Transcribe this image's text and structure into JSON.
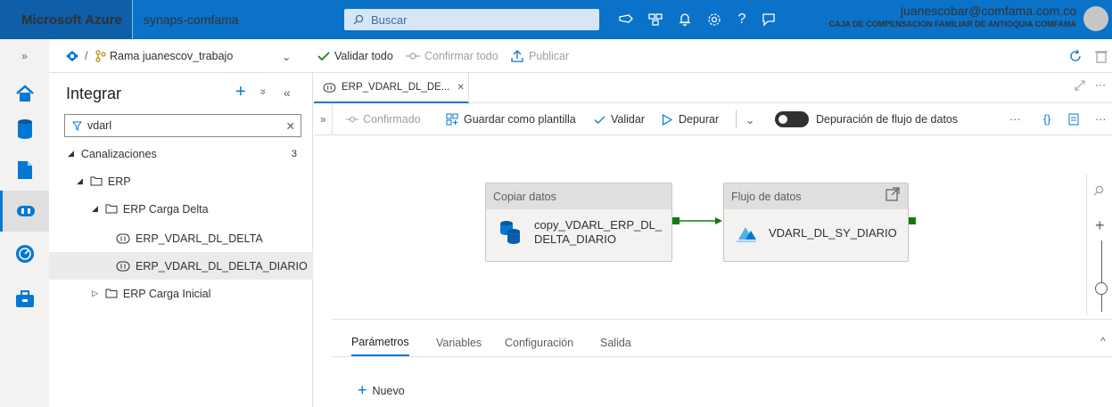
{
  "topbar": {
    "brand": "Microsoft Azure",
    "workspace": "synaps-comfama",
    "search_placeholder": "Buscar",
    "user_email": "juanescobar@comfama.com.co",
    "user_org": "CAJA DE COMPENSACION FAMILIAR DE ANTIOQUIA COMFAMA",
    "icons": [
      "feedback-icon",
      "directory-icon",
      "notifications-icon",
      "settings-icon",
      "help-icon",
      "feedback-smile-icon"
    ],
    "help_glyph": "?"
  },
  "repo_bar": {
    "collapse": "»",
    "separator": "/",
    "branch": "Rama juanescov_trabajo",
    "chevron": "⌄",
    "validate_all": "Validar todo",
    "commit_all": "Confirmar todo",
    "publish": "Publicar"
  },
  "resources": {
    "title": "Integrar",
    "add": "+",
    "collapse_all": "»",
    "hide": "«",
    "filter_value": "vdarl",
    "clear": "✕",
    "tree": [
      {
        "label": "Canalizaciones",
        "count": "3"
      },
      {
        "label": "ERP"
      },
      {
        "label": "ERP Carga Delta"
      },
      {
        "label": "ERP_VDARL_DL_DELTA"
      },
      {
        "label": "ERP_VDARL_DL_DELTA_DIARIO",
        "selected": true
      },
      {
        "label": "ERP Carga Inicial"
      }
    ]
  },
  "doc_tab": {
    "label": "ERP_VDARL_DL_DE...",
    "close": "✕",
    "expand_left": "»",
    "ellipsis": "···"
  },
  "toolbar": {
    "confirmed": "Confirmado",
    "save_template": "Guardar como plantilla",
    "validate": "Validar",
    "debug": "Depurar",
    "dropdown": "⌄",
    "dataflow_debug": "Depuración de flujo de datos",
    "more": "···",
    "code": "{}",
    "properties": "≡"
  },
  "canvas": {
    "activity1": {
      "type": "Copiar datos",
      "name_line1": "copy_VDARL_ERP_DL_",
      "name_line2": "DELTA_DIARIO"
    },
    "activity2": {
      "type": "Flujo de datos",
      "name": "VDARL_DL_SY_DIARIO"
    },
    "zoom_in": "+"
  },
  "bottom": {
    "tabs": [
      "Parámetros",
      "Variables",
      "Configuración",
      "Salida"
    ],
    "new_button": "Nuevo",
    "collapse": "^"
  },
  "colors": {
    "azure_blue": "#0a72c9",
    "accent": "#0078d4",
    "success_green": "#107c10"
  }
}
